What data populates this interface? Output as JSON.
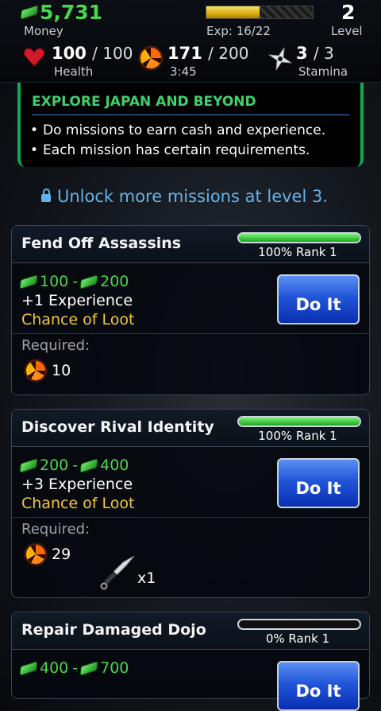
{
  "hud": {
    "money": "5,731",
    "money_label": "Money",
    "exp_text": "Exp: 16/22",
    "exp_progress": 0.5,
    "level": "2",
    "level_label": "Level",
    "health": "100",
    "health_max": "/ 100",
    "health_label": "Health",
    "energy": "171",
    "energy_max": "/ 200",
    "energy_timer": "3:45",
    "stamina": "3",
    "stamina_max": "/ 3",
    "stamina_label": "Stamina"
  },
  "intro": {
    "title": "EXPLORE JAPAN AND BEYOND",
    "bullets": [
      "Do missions to earn cash and experience.",
      "Each mission has certain requirements."
    ]
  },
  "unlock_text": "Unlock more missions at level 3.",
  "colors": {
    "accent_green": "#13a852",
    "cash_green": "#4bd64b",
    "loot_gold": "#f3c63c",
    "button_blue": "#2155d9"
  },
  "missions": [
    {
      "title": "Fend Off Assassins",
      "mastery": 1.0,
      "rank_text": "100% Rank 1",
      "cash_min": "100",
      "cash_sep": "-",
      "cash_max": "200",
      "experience": "+1 Experience",
      "loot": "Chance of Loot",
      "required_label": "Required:",
      "energy_required": "10",
      "button_label": "Do It"
    },
    {
      "title": "Discover Rival Identity",
      "mastery": 1.0,
      "rank_text": "100% Rank 1",
      "cash_min": "200",
      "cash_sep": "-",
      "cash_max": "400",
      "experience": "+3 Experience",
      "loot": "Chance of Loot",
      "required_label": "Required:",
      "energy_required": "29",
      "item_icon": "kunai-icon",
      "item_qty": "x1",
      "button_label": "Do It"
    },
    {
      "title": "Repair Damaged Dojo",
      "mastery": 0.0,
      "rank_text": "0% Rank 1",
      "cash_min": "400",
      "cash_sep": "-",
      "cash_max": "700",
      "button_label": "Do It"
    }
  ]
}
